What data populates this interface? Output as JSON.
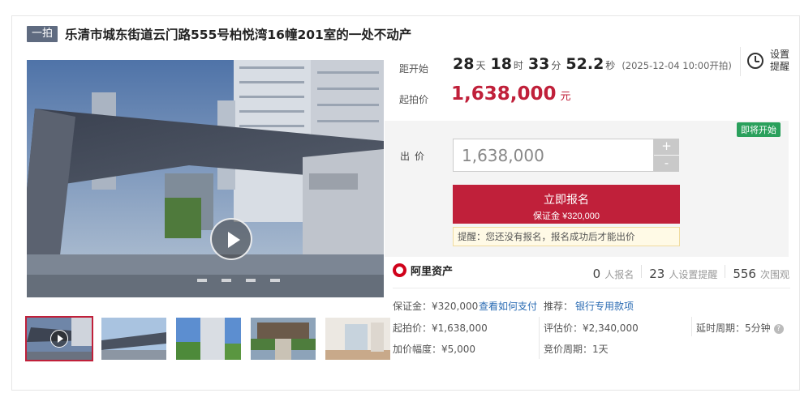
{
  "header": {
    "round_tag": "一拍",
    "title": "乐清市城东街道云门路555号柏悦湾16幢201室的一处不动产"
  },
  "countdown": {
    "label": "距开始",
    "days": "28",
    "days_unit": "天",
    "hours": "18",
    "hours_unit": "时",
    "minutes": "33",
    "minutes_unit": "分",
    "seconds": "52.2",
    "seconds_unit": "秒",
    "start_note": "(2025-12-04 10:00开拍)"
  },
  "reminder": {
    "label": "设置提醒"
  },
  "price": {
    "label": "起拍价",
    "value": "1,638,000",
    "unit": "元"
  },
  "bid": {
    "status_badge": "即将开始",
    "label": "出价",
    "input_value": "1,638,000",
    "plus": "+",
    "minus": "-",
    "signup_label": "立即报名",
    "deposit_label": "保证金 ¥320,000",
    "notice": "提醒：您还没有报名，报名成功后才能出价"
  },
  "platform": {
    "name": "阿里资产",
    "signups": "0",
    "signups_unit": "人报名",
    "reminders": "23",
    "reminders_unit": "人设置提醒",
    "views": "556",
    "views_unit": "次围观"
  },
  "details": {
    "deposit": "保证金：¥320,000",
    "how_to_pay": "查看如何支付",
    "recommend": "推荐：",
    "bank_link": "银行专用款项",
    "start_price": "起拍价：¥1,638,000",
    "appraisal": "评估价：¥2,340,000",
    "delay": "延时周期：5分钟",
    "increment": "加价幅度：¥5,000",
    "period": "竞价周期：1天"
  },
  "colors": {
    "accent": "#c0203a",
    "badge_green": "#2aa05c",
    "link": "#2a6bb3"
  },
  "icons": {
    "play": "play-icon",
    "clock": "alarm-clock-icon",
    "help": "question-icon",
    "logo": "ali-assets-logo"
  }
}
